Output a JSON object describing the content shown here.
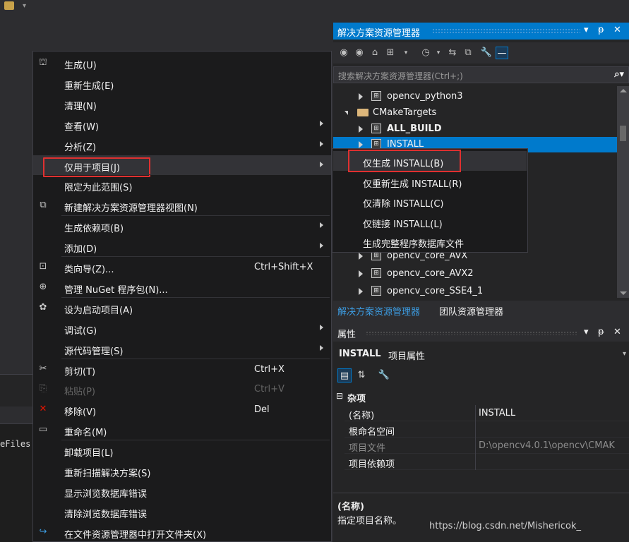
{
  "background": {
    "code_fragment": "eFiles"
  },
  "context_menu": {
    "items": [
      {
        "label": "生成(U)",
        "icon": "build-icon",
        "shortcut": "",
        "submenu": false,
        "disabled": false
      },
      {
        "label": "重新生成(E)",
        "icon": "",
        "shortcut": "",
        "submenu": false,
        "disabled": false
      },
      {
        "label": "清理(N)",
        "icon": "",
        "shortcut": "",
        "submenu": false,
        "disabled": false
      },
      {
        "label": "查看(W)",
        "icon": "",
        "shortcut": "",
        "submenu": true,
        "disabled": false
      },
      {
        "label": "分析(Z)",
        "icon": "",
        "shortcut": "",
        "submenu": true,
        "disabled": false
      },
      {
        "label": "仅用于项目(J)",
        "icon": "",
        "shortcut": "",
        "submenu": true,
        "disabled": false,
        "active": true
      },
      {
        "label": "限定为此范围(S)",
        "icon": "",
        "shortcut": "",
        "submenu": false,
        "disabled": false
      },
      {
        "label": "新建解决方案资源管理器视图(N)",
        "icon": "new-view-icon",
        "shortcut": "",
        "submenu": false,
        "disabled": false
      },
      {
        "label": "生成依赖项(B)",
        "icon": "",
        "shortcut": "",
        "submenu": true,
        "disabled": false
      },
      {
        "label": "添加(D)",
        "icon": "",
        "shortcut": "",
        "submenu": true,
        "disabled": false
      },
      {
        "label": "类向导(Z)...",
        "icon": "class-wizard-icon",
        "shortcut": "Ctrl+Shift+X",
        "submenu": false,
        "disabled": false
      },
      {
        "label": "管理 NuGet 程序包(N)...",
        "icon": "nuget-icon",
        "shortcut": "",
        "submenu": false,
        "disabled": false
      },
      {
        "label": "设为启动项目(A)",
        "icon": "gear-icon",
        "shortcut": "",
        "submenu": false,
        "disabled": false
      },
      {
        "label": "调试(G)",
        "icon": "",
        "shortcut": "",
        "submenu": true,
        "disabled": false
      },
      {
        "label": "源代码管理(S)",
        "icon": "",
        "shortcut": "",
        "submenu": true,
        "disabled": false
      },
      {
        "label": "剪切(T)",
        "icon": "scissors-icon",
        "shortcut": "Ctrl+X",
        "submenu": false,
        "disabled": false
      },
      {
        "label": "粘贴(P)",
        "icon": "paste-icon",
        "shortcut": "Ctrl+V",
        "submenu": false,
        "disabled": true
      },
      {
        "label": "移除(V)",
        "icon": "delete-icon",
        "shortcut": "Del",
        "submenu": false,
        "disabled": false
      },
      {
        "label": "重命名(M)",
        "icon": "rename-icon",
        "shortcut": "",
        "submenu": false,
        "disabled": false
      },
      {
        "label": "卸载项目(L)",
        "icon": "",
        "shortcut": "",
        "submenu": false,
        "disabled": false
      },
      {
        "label": "重新扫描解决方案(S)",
        "icon": "",
        "shortcut": "",
        "submenu": false,
        "disabled": false
      },
      {
        "label": "显示浏览数据库错误",
        "icon": "",
        "shortcut": "",
        "submenu": false,
        "disabled": false
      },
      {
        "label": "清除浏览数据库错误",
        "icon": "",
        "shortcut": "",
        "submenu": false,
        "disabled": false
      },
      {
        "label": "在文件资源管理器中打开文件夹(X)",
        "icon": "refresh-arrow-icon",
        "shortcut": "",
        "submenu": false,
        "disabled": false
      }
    ]
  },
  "submenu": {
    "items": [
      {
        "label": "仅生成 INSTALL(B)",
        "active": true
      },
      {
        "label": "仅重新生成 INSTALL(R)"
      },
      {
        "label": "仅清除 INSTALL(C)"
      },
      {
        "label": "仅链接 INSTALL(L)"
      },
      {
        "label": "生成完整程序数据库文件"
      }
    ]
  },
  "solution_explorer": {
    "title": "解决方案资源管理器",
    "search_placeholder": "搜索解决方案资源管理器(Ctrl+;)",
    "tree": [
      {
        "name": "opencv_python3",
        "level": 1,
        "kind": "project",
        "expanded": false,
        "bold": false
      },
      {
        "name": "CMakeTargets",
        "level": 0,
        "kind": "folder",
        "expanded": true,
        "bold": false
      },
      {
        "name": "ALL_BUILD",
        "level": 1,
        "kind": "project",
        "expanded": false,
        "bold": true
      },
      {
        "name": "INSTALL",
        "level": 1,
        "kind": "project",
        "expanded": false,
        "bold": false,
        "selected": true
      },
      {
        "name": "opencv_core_AVX",
        "level": 1,
        "kind": "project",
        "expanded": false,
        "bold": false
      },
      {
        "name": "opencv_core_AVX2",
        "level": 1,
        "kind": "project",
        "expanded": false,
        "bold": false
      },
      {
        "name": "opencv_core_SSE4_1",
        "level": 1,
        "kind": "project",
        "expanded": false,
        "bold": false
      }
    ],
    "tabs": [
      {
        "label": "解决方案资源管理器",
        "active": true
      },
      {
        "label": "团队资源管理器",
        "active": false
      }
    ]
  },
  "properties": {
    "title": "属性",
    "object_name": "INSTALL",
    "object_type": "项目属性",
    "category": "杂项",
    "rows": [
      {
        "key": "(名称)",
        "value": "INSTALL",
        "dim": false
      },
      {
        "key": "根命名空间",
        "value": "",
        "dim": false
      },
      {
        "key": "项目文件",
        "value": "D:\\opencv4.0.1\\opencv\\CMAK",
        "dim": true
      },
      {
        "key": "项目依赖项",
        "value": "",
        "dim": false
      }
    ],
    "description_title": "(名称)",
    "description_text": "指定项目名称。"
  },
  "watermark": "https://blog.csdn.net/Mishericok_",
  "colors": {
    "accent": "#007acc",
    "highlight_box": "#e03030",
    "menu_bg": "#1b1b1c"
  }
}
